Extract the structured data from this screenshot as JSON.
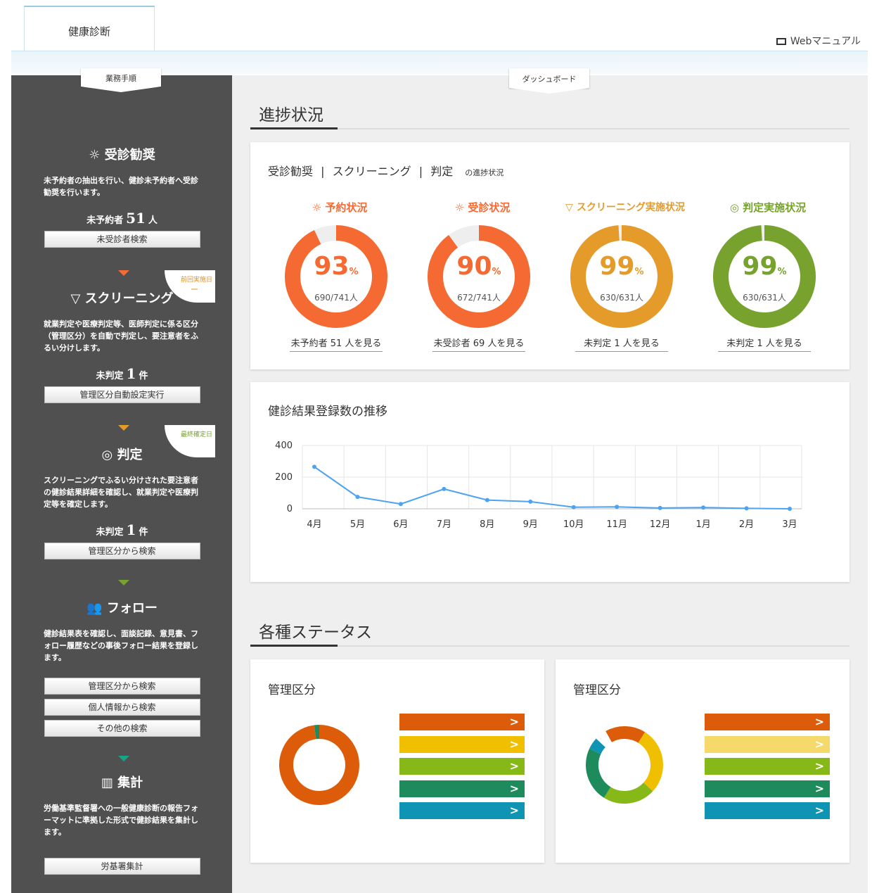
{
  "header": {
    "tab_label": "健康診断",
    "manual_label": "Webマニュアル"
  },
  "sidebar": {
    "flag_label": "業務手順",
    "cards": [
      {
        "title": "受診勧奨",
        "desc": "未予約者の抽出を行い、健診未予約者へ受診勧奨を行います。",
        "count_label": "未予約者",
        "count_value": "51",
        "count_unit": "人",
        "buttons": [
          "未受診者検索"
        ],
        "color": "#f46a32"
      },
      {
        "title": "スクリーニング",
        "corner": "前回実施日",
        "corner_value": "ー",
        "desc": "就業判定や医療判定等、医師判定に係る区分（管理区分）を自動で判定し、要注意者をふるい分けします。",
        "count_label": "未判定",
        "count_value": "1",
        "count_unit": "件",
        "buttons": [
          "管理区分自動設定実行"
        ],
        "color": "#e59b2a"
      },
      {
        "title": "判定",
        "corner": "最終確定日",
        "desc": "スクリーニングでふるい分けされた要注意者の健診結果詳細を確認し、就業判定や医療判定等を確定します。",
        "count_label": "未判定",
        "count_value": "1",
        "count_unit": "件",
        "buttons": [
          "管理区分から検索"
        ],
        "color": "#76a22d"
      },
      {
        "title": "フォロー",
        "desc": "健診結果表を確認し、面談記録、意見書、フォロー履歴などの事後フォロー結果を登録します。",
        "buttons": [
          "管理区分から検索",
          "個人情報から検索",
          "その他の検索"
        ],
        "color": "#16a588"
      },
      {
        "title": "集計",
        "desc": "労働基準監督署への一般健康診断の報告フォーマットに準拠した形式で健診結果を集計します。",
        "buttons": [
          "労基署集計"
        ],
        "color": "#0f8d8a"
      }
    ]
  },
  "main": {
    "flag_label": "ダッシュボード",
    "progress_section_title": "進捗状況",
    "progress_panel": {
      "t1": "受診勧奨",
      "sep": "|",
      "t2": "スクリーニング",
      "t3": "判定",
      "suffix": "の進捗状況",
      "donuts": [
        {
          "title": "予約状況",
          "percent": "93",
          "pct_sign": "%",
          "detail": "690/741人",
          "link": "未予約者 51 人を見る",
          "value": 0.93,
          "color": "#f46a32"
        },
        {
          "title": "受診状況",
          "percent": "90",
          "pct_sign": "%",
          "detail": "672/741人",
          "link": "未受診者 69 人を見る",
          "value": 0.9,
          "color": "#f46a32"
        },
        {
          "title": "スクリーニング実施状況",
          "percent": "99",
          "pct_sign": "%",
          "detail": "630/631人",
          "link": "未判定 1 人を見る",
          "value": 0.99,
          "color": "#e59b2a"
        },
        {
          "title": "判定実施状況",
          "percent": "99",
          "pct_sign": "%",
          "detail": "630/631人",
          "link": "未判定 1 人を見る",
          "value": 0.99,
          "color": "#76a22d"
        }
      ]
    },
    "trend_panel": {
      "title": "健診結果登録数の推移"
    },
    "status_section_title": "各種ステータス",
    "status_panels": [
      {
        "title": "管理区分",
        "slices": [
          {
            "value": 0.98,
            "color": "#dd5c0a"
          },
          {
            "value": 0.02,
            "color": "#1d8b5c"
          }
        ],
        "bars": [
          "#dd5c0a",
          "#f0c000",
          "#86b817",
          "#1d8b5c",
          "#0f94b4"
        ],
        "chev": ">"
      },
      {
        "title": "管理区分",
        "slices": [
          {
            "value": 0.17,
            "color": "#dd5c0a"
          },
          {
            "value": 0.28,
            "color": "#f0c000"
          },
          {
            "value": 0.22,
            "color": "#86b817"
          },
          {
            "value": 0.23,
            "color": "#1d8b5c"
          },
          {
            "value": 0.05,
            "color": "#0f94b4"
          }
        ],
        "bars": [
          "#dd5c0a",
          "#f5d96b",
          "#86b817",
          "#1d8b5c",
          "#0f94b4"
        ],
        "chev": ">"
      }
    ]
  },
  "chart_data": {
    "type": "line",
    "title": "健診結果登録数の推移",
    "categories": [
      "4月",
      "5月",
      "6月",
      "7月",
      "8月",
      "9月",
      "10月",
      "11月",
      "12月",
      "1月",
      "2月",
      "3月"
    ],
    "values": [
      265,
      75,
      30,
      125,
      55,
      45,
      10,
      12,
      5,
      8,
      3,
      0
    ],
    "yticks": [
      0,
      200,
      400
    ],
    "ylim": [
      0,
      400
    ],
    "color": "#4da3f0",
    "grid": true
  }
}
